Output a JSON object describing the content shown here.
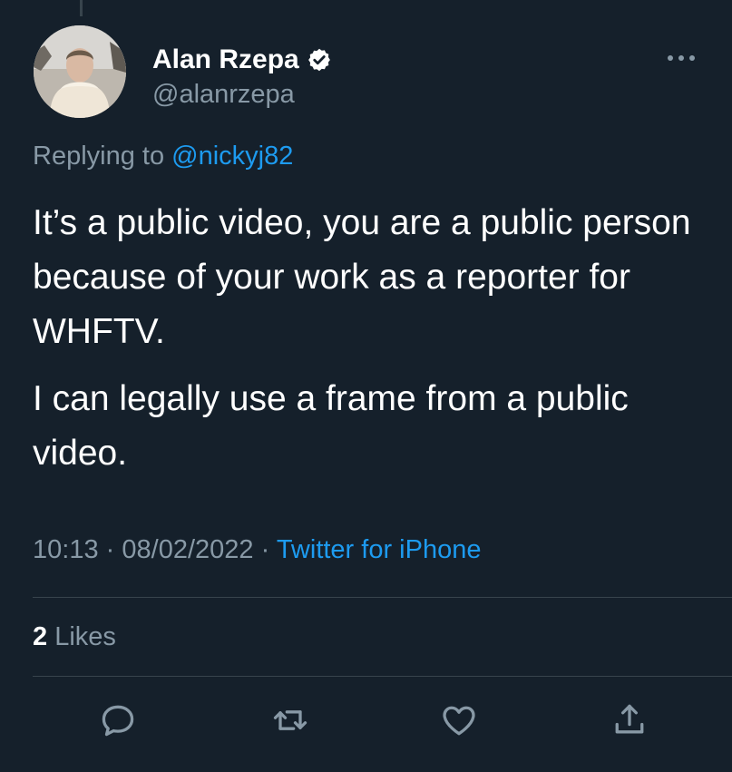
{
  "author": {
    "name": "Alan Rzepa",
    "handle": "@alanrzepa"
  },
  "reply": {
    "prefix": "Replying to",
    "mention": "@nickyj82"
  },
  "tweet": {
    "paragraphs": [
      "It’s a public video, you are a public person because of your work as a reporter for WHFTV.",
      "I can legally use a frame from a public video."
    ]
  },
  "meta": {
    "time": "10:13",
    "separator": "·",
    "date": "08/02/2022",
    "source": "Twitter for iPhone"
  },
  "stats": {
    "likes_count": "2",
    "likes_label": "Likes"
  },
  "icons": {
    "verified": "verified-badge-icon",
    "more": "more-dots-icon",
    "reply": "reply-icon",
    "retweet": "retweet-icon",
    "like": "heart-icon",
    "share": "share-icon"
  },
  "colors": {
    "background": "#15202b",
    "accent": "#1d9bf0",
    "muted": "#8899a6"
  }
}
